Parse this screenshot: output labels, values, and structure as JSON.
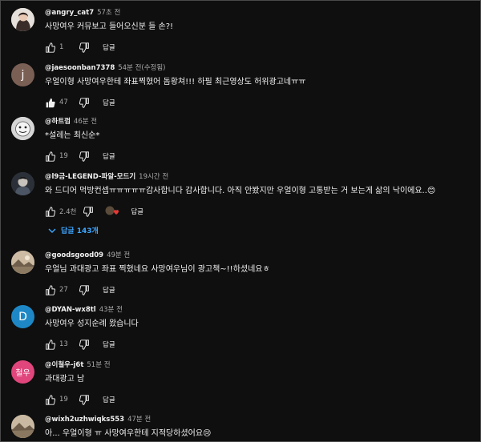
{
  "comments": [
    {
      "author": "@angry_cat7",
      "time": "57초 전",
      "text": "사망여우 커뮤보고 들어오신분 들 손?!",
      "likes": "1",
      "reply": "답글",
      "avatar_bg": "#d9d4cf",
      "avatar_icon": "person-photo-icon"
    },
    {
      "author": "@jaesoonban7378",
      "time": "54분 전(수정됨)",
      "text": "우얼이형 사망여우한테 좌표찍혔어 돔황쳐!!! 하필 최근영상도 허위광고네ㅠㅠ",
      "likes": "47",
      "reply": "답글",
      "avatar_bg": "#7a5f55",
      "avatar_letter": "j"
    },
    {
      "author": "@하트껌",
      "time": "46분 전",
      "text": "*설레는 최신순*",
      "likes": "19",
      "reply": "답글",
      "avatar_bg": "#c8c8c8",
      "avatar_icon": "cartoon-face-icon"
    },
    {
      "author": "@l9금-LEGEND-파알-모드기",
      "time": "19시간 전",
      "text": "와 드디어 먹방컨셉ㅠㅠㅠㅠㅠ감사합니다 감사합니다. 아직 안봤지만 우얼이형 고통받는 거 보는게 삶의 낙이에요..😊",
      "likes": "2.4천",
      "reply": "답글",
      "avatar_bg": "#3a3f4a",
      "avatar_icon": "character-photo-icon",
      "replies_label": "답글 143개"
    },
    {
      "author": "@goodsgood09",
      "time": "49분 전",
      "text": "우얼님 과대광고 좌표 찍혔네요 사망여우님이 광고책~!!하셨네요ㅎ",
      "likes": "27",
      "reply": "답글",
      "avatar_bg": "#b9a48a",
      "avatar_icon": "landscape-photo-icon"
    },
    {
      "author": "@DYAN-wx8tl",
      "time": "43분 전",
      "text": "사망여우 성지순례 왔습니다",
      "likes": "13",
      "reply": "답글",
      "avatar_bg": "#1e88c7",
      "avatar_letter": "D"
    },
    {
      "author": "@이철우-j6t",
      "time": "51분 전",
      "text": "과대광고 남",
      "likes": "19",
      "reply": "답글",
      "avatar_bg": "#e0457b",
      "avatar_letter": "철우"
    },
    {
      "author": "@wixh2uzhwiqks553",
      "time": "47분 전",
      "text": "아... 우얼이형 ㅠ 사망여우한테 지적당하셨어요😢",
      "likes": "",
      "reply": "",
      "avatar_bg": "#b8a894",
      "avatar_icon": "landscape-photo-icon"
    }
  ],
  "colors": {
    "background": "#0f0f0f",
    "link": "#3ea6ff",
    "heart": "#e53935"
  }
}
